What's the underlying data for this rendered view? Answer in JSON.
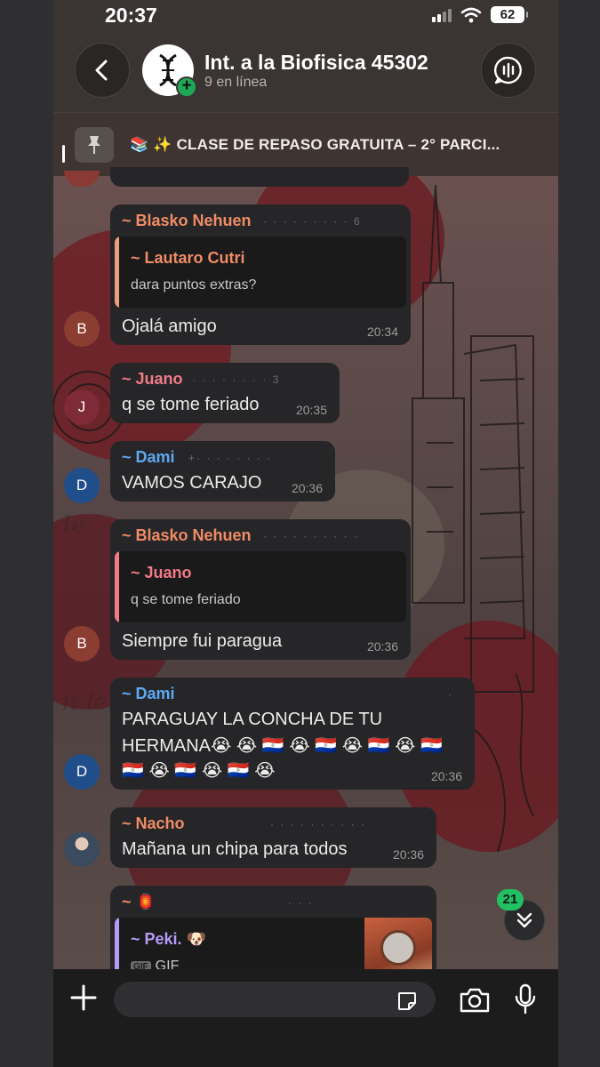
{
  "status": {
    "time": "20:37",
    "battery": "62"
  },
  "header": {
    "title": "Int. a la Biofisica 45302",
    "subtitle": "9 en línea"
  },
  "pinned": {
    "text": "📚 ✨ CLASE DE REPASO GRATUITA – 2° PARCI..."
  },
  "messages": [
    {
      "sender": "~ Blasko Nehuen",
      "reply_sender": "~ Lautaro Cutri",
      "reply_text": "dara puntos extras?",
      "text": "Ojalá amigo",
      "time": "20:34",
      "avatar": "B"
    },
    {
      "sender": "~ Juano",
      "text": "q se tome feriado",
      "time": "20:35",
      "avatar": "J"
    },
    {
      "sender": "~ Dami",
      "text": "VAMOS CARAJO",
      "time": "20:36",
      "avatar": "D"
    },
    {
      "sender": "~ Blasko Nehuen",
      "reply_sender": "~ Juano",
      "reply_text": "q se tome feriado",
      "text": "Siempre fui paragua",
      "time": "20:36",
      "avatar": "B"
    },
    {
      "sender": "~ Dami",
      "line1": "PARAGUAY LA CONCHA DE TU",
      "line2": "HERMANA😭 😭 🇵🇾 😭 🇵🇾 😭 🇵🇾 😭 🇵🇾",
      "line3": "🇵🇾 😭 🇵🇾 😭 🇵🇾 😭",
      "time": "20:36",
      "avatar": "D"
    },
    {
      "sender": "~ Nacho",
      "text": "Mañana un chipa para todos",
      "time": "20:36"
    },
    {
      "sender": "~ 🏮",
      "reply_sender": "~ Peki. 🐶",
      "reply_text": "GIF",
      "gif_tag": "GIF"
    }
  ],
  "scroll": {
    "unread": "21"
  },
  "colors": {
    "orange": "#f08b66",
    "pink": "#f07a86",
    "blue": "#5ea9f3",
    "purple": "#b79bf5",
    "green": "#21c063"
  }
}
